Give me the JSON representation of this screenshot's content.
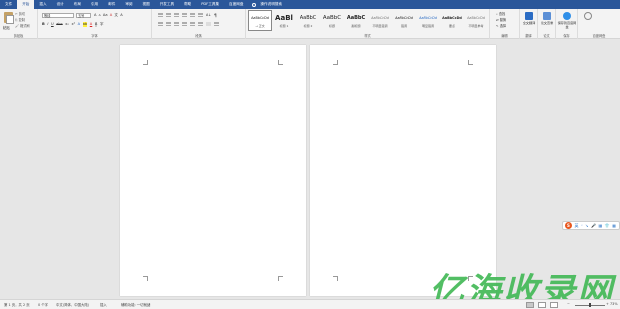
{
  "tabs": [
    "文件",
    "开始",
    "插入",
    "设计",
    "布局",
    "引用",
    "邮件",
    "审阅",
    "视图",
    "开发工具",
    "帮助",
    "PDF工具集",
    "百度网盘"
  ],
  "active_tab_index": 1,
  "tell_me": "操作说明搜索",
  "clipboard": {
    "paste": "粘贴",
    "cut": "剪切",
    "copy": "复制",
    "format_painter": "格式刷",
    "label": "剪贴板"
  },
  "font": {
    "name": "等线",
    "size": "五号",
    "grow": "A",
    "shrink": "A",
    "case": "Aa",
    "clear": "A",
    "pinyin": "文",
    "border": "A",
    "bold": "B",
    "italic": "I",
    "underline": "U",
    "strike": "abc",
    "sub": "x₂",
    "sup": "x²",
    "effects": "A",
    "highlight": "ab",
    "color": "A",
    "shade": "A",
    "circle": "字",
    "label": "字体"
  },
  "paragraph": {
    "label": "段落",
    "sort": "A↓",
    "marks": "¶"
  },
  "styles": {
    "label": "样式",
    "items": [
      {
        "preview": "AaBbCcDd",
        "name": "→ 正文"
      },
      {
        "preview": "AaBl",
        "name": "标题 1"
      },
      {
        "preview": "AaBbC",
        "name": "标题 2"
      },
      {
        "preview": "AaBbC",
        "name": "标题"
      },
      {
        "preview": "AaBbC",
        "name": "副标题"
      },
      {
        "preview": "AaBbCcDd",
        "name": "不明显强调"
      },
      {
        "preview": "AaBbCcDd",
        "name": "强调"
      },
      {
        "preview": "AaBbCcDd",
        "name": "明显强调"
      },
      {
        "preview": "AaBbCcDd",
        "name": "要点"
      },
      {
        "preview": "AaBbCcDd",
        "name": "不明显参考"
      }
    ]
  },
  "editing": {
    "find": "查找",
    "replace": "替换",
    "select": "选择",
    "label": "编辑"
  },
  "translate": {
    "btn": "全文翻译",
    "label": "翻译"
  },
  "paper": {
    "btn": "论文查重",
    "label": "论文"
  },
  "save_baidu": {
    "btn": "保存到百度网盘",
    "label": "保存"
  },
  "cloud": {
    "label": "百度网盘"
  },
  "status": {
    "page": "第 1 页，共 2 页",
    "words": "0 个字",
    "language": "中文(简体，中国大陆)",
    "insert": "插入",
    "accessibility": "辅助功能: 一切就绪",
    "zoom": "73%"
  },
  "floatbar": {
    "brand": "S",
    "items": [
      "英",
      "ᵕ",
      "↘",
      "🎤",
      "▦",
      "👕",
      "▦"
    ]
  },
  "watermark": "亿海收录网",
  "colors": {
    "accent": "#2b579a",
    "watermark": "#40b854"
  }
}
